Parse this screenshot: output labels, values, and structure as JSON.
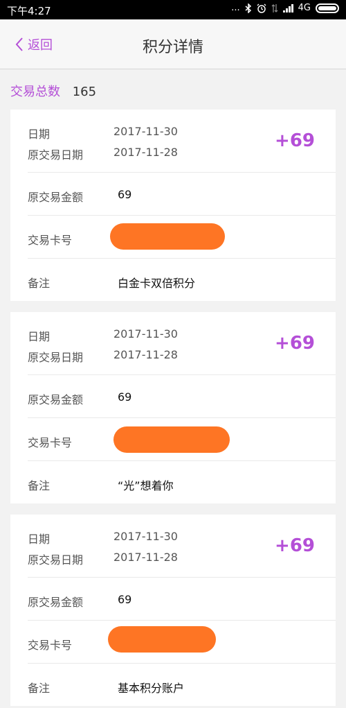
{
  "status": {
    "time": "下午4:27",
    "dots": "...",
    "net": "4G"
  },
  "nav": {
    "back_label": "返回",
    "title": "积分详情"
  },
  "summary": {
    "label": "交易总数",
    "count": "165"
  },
  "labels": {
    "date": "日期",
    "orig_date": "原交易日期",
    "orig_amount": "原交易金额",
    "card_no": "交易卡号",
    "remark": "备注"
  },
  "records": [
    {
      "date": "2017-11-30",
      "orig_date": "2017-11-28",
      "orig_amount": "69",
      "points": "+69",
      "remark": "白金卡双倍积分"
    },
    {
      "date": "2017-11-30",
      "orig_date": "2017-11-28",
      "orig_amount": "69",
      "points": "+69",
      "remark": "“光”想着你"
    },
    {
      "date": "2017-11-30",
      "orig_date": "2017-11-28",
      "orig_amount": "69",
      "points": "+69",
      "remark": "基本积分账户"
    }
  ],
  "colors": {
    "accent": "#b44fd7",
    "redaction": "#fe7524"
  }
}
